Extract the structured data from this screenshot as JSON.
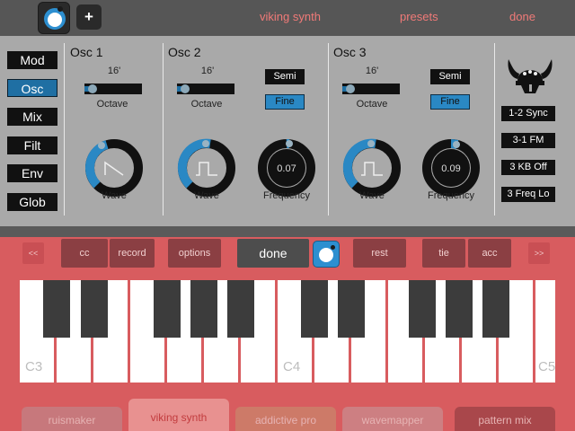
{
  "topbar": {
    "title": "viking synth",
    "presets": "presets",
    "done": "done",
    "plus": "+"
  },
  "tabs": [
    "Mod",
    "Osc",
    "Mix",
    "Filt",
    "Env",
    "Glob"
  ],
  "active_tab": "Osc",
  "oscillators": [
    {
      "title": "Osc 1",
      "octave_value": "16'",
      "octave_label": "Octave",
      "wave_label": "Wave"
    },
    {
      "title": "Osc 2",
      "octave_value": "16'",
      "octave_label": "Octave",
      "wave_label": "Wave",
      "semi": "Semi",
      "fine": "Fine",
      "frequency_value": "0.07",
      "frequency_label": "Frequency"
    },
    {
      "title": "Osc 3",
      "octave_value": "16'",
      "octave_label": "Octave",
      "wave_label": "Wave",
      "semi": "Semi",
      "fine": "Fine",
      "frequency_value": "0.09",
      "frequency_label": "Frequency"
    }
  ],
  "options": [
    "1-2 Sync",
    "3-1 FM",
    "3 KB Off",
    "3 Freq Lo"
  ],
  "controls": {
    "prev": "<<",
    "cc": "cc",
    "record": "record",
    "options": "options",
    "done": "done",
    "rest": "rest",
    "tie": "tie",
    "acc": "acc",
    "next": ">>"
  },
  "keyboard": {
    "labels": [
      "C3",
      "C4",
      "C5"
    ]
  },
  "bottom_tabs": [
    "ruismaker",
    "viking synth",
    "addictive pro",
    "wavemapper",
    "pattern mix"
  ],
  "active_bottom_tab": "viking synth",
  "colors": {
    "accent": "#2a88c4",
    "panel": "#a9a9a9",
    "keyboard_bg": "#d85c5f",
    "topbar_text": "#f07a78"
  }
}
